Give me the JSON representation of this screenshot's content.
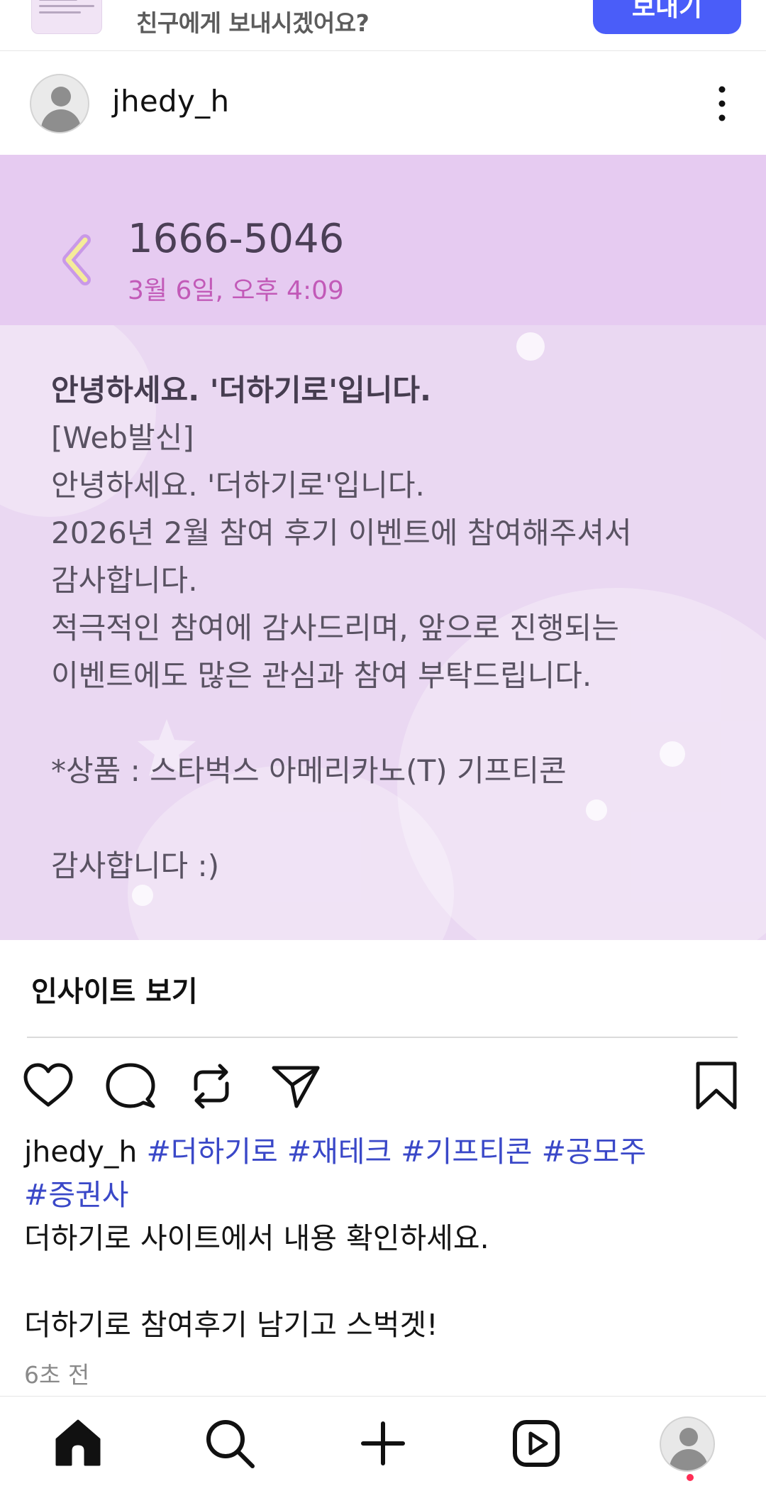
{
  "share_banner": {
    "prompt": "친구에게 보내시겠어요?",
    "send_label": "보내기"
  },
  "post": {
    "username": "jhedy_h",
    "image": {
      "sender_number": "1666-5046",
      "sent_time": "3월 6일, 오후 4:09",
      "message_lines": [
        "안녕하세요. '더하기로'입니다.",
        "[Web발신]",
        "안녕하세요. '더하기로'입니다.",
        "2026년 2월 참여 후기 이벤트에 참여해주셔서",
        "감사합니다.",
        "적극적인 참여에 감사드리며, 앞으로 진행되는",
        "이벤트에도 많은 관심과 참여 부탁드립니다.",
        "",
        "*상품 : 스타벅스 아메리카노(T) 기프티콘",
        "",
        "감사합니다 :)"
      ]
    },
    "insights_label": "인사이트 보기",
    "caption": {
      "handle": "jhedy_h",
      "hashtags": [
        "#더하기로",
        "#재테크",
        "#기프티콘",
        "#공모주",
        "#증권사"
      ],
      "lines": [
        "더하기로 사이트에서 내용 확인하세요.",
        "",
        "더하기로 참여후기 남기고 스벅겟!"
      ]
    },
    "timestamp": "6초 전"
  },
  "actions": [
    "heart-icon",
    "comment-icon",
    "repost-icon",
    "share-icon",
    "bookmark-icon"
  ],
  "bottom_nav": [
    "home-icon",
    "search-icon",
    "create-icon",
    "reels-icon",
    "profile-avatar"
  ],
  "colors": {
    "send_button": "#4a5df9",
    "hashtag": "#3a48c8",
    "image_bg": "#ead8f2",
    "image_header": "#e6cbf1",
    "time_pink": "#c25ab8",
    "notification": "#ff2d55"
  }
}
